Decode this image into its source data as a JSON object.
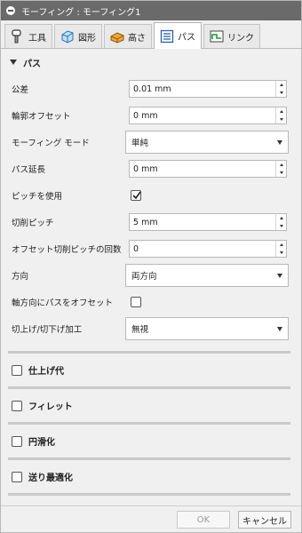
{
  "window": {
    "title": "モーフィング : モーフィング1"
  },
  "tabs": [
    {
      "label": "工具",
      "icon": "tool-icon"
    },
    {
      "label": "図形",
      "icon": "geometry-icon"
    },
    {
      "label": "高さ",
      "icon": "heights-icon"
    },
    {
      "label": "パス",
      "icon": "passes-icon"
    },
    {
      "label": "リンク",
      "icon": "linking-icon"
    }
  ],
  "section": {
    "title": "パス"
  },
  "fields": {
    "tolerance": {
      "label": "公差",
      "value": "0.01 mm"
    },
    "contour_offset": {
      "label": "輪郭オフセット",
      "value": "0 mm"
    },
    "morph_mode": {
      "label": "モーフィング モード",
      "value": "単純"
    },
    "pass_extension": {
      "label": "パス延長",
      "value": "0 mm"
    },
    "use_stepover": {
      "label": "ピッチを使用",
      "checked": true
    },
    "stepover": {
      "label": "切削ピッチ",
      "value": "5 mm"
    },
    "offset_stepover_count": {
      "label": "オフセット切削ピッチの回数",
      "value": "0"
    },
    "direction": {
      "label": "方向",
      "value": "両方向"
    },
    "axial_offset": {
      "label": "軸方向にパスをオフセット",
      "checked": false
    },
    "ramp": {
      "label": "切上げ/切下げ加工",
      "value": "無視"
    }
  },
  "collapsed_sections": [
    {
      "label": "仕上げ代"
    },
    {
      "label": "フィレット"
    },
    {
      "label": "円滑化"
    },
    {
      "label": "送り最適化"
    }
  ],
  "footer": {
    "ok_label": "OK",
    "cancel_label": "キャンセル"
  }
}
